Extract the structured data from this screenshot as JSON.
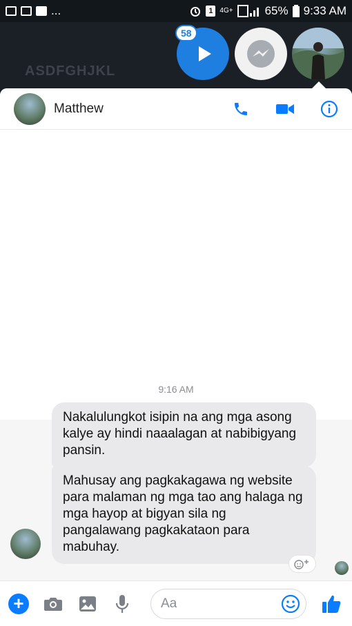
{
  "status_bar": {
    "left_more": "...",
    "network": "4G+",
    "battery_percent": "65%",
    "time": "9:33 AM",
    "sim_slot": "1"
  },
  "wallpaper_text": "ASDFGHJKL",
  "chat_heads": {
    "badge_count": "58"
  },
  "chat_header": {
    "contact_name": "Matthew"
  },
  "conversation": {
    "timestamp": "9:16 AM",
    "messages": [
      {
        "sender": "Matthew",
        "text": "Nakalulungkot isipin na ang mga asong kalye ay hindi naaalagan at nabibigyang pansin."
      },
      {
        "sender": "Matthew",
        "text": "Mahusay ang pagkakagawa ng website para malaman ng mga tao ang halaga ng mga hayop at bigyan sila ng pangalawang pagkakataon para mabuhay."
      }
    ]
  },
  "composer": {
    "placeholder": "Aa"
  },
  "colors": {
    "messenger_blue": "#0a7cff",
    "bubble_gray": "#e9e9eb"
  },
  "icons": [
    "gallery-icon",
    "shop-icon",
    "folder-icon",
    "alarm-icon",
    "signal-icon",
    "battery-icon",
    "play-icon",
    "messenger-icon",
    "phone-icon",
    "video-icon",
    "info-icon",
    "plus-icon",
    "camera-icon",
    "image-icon",
    "microphone-icon",
    "emoji-icon",
    "like-icon",
    "react-icon"
  ]
}
